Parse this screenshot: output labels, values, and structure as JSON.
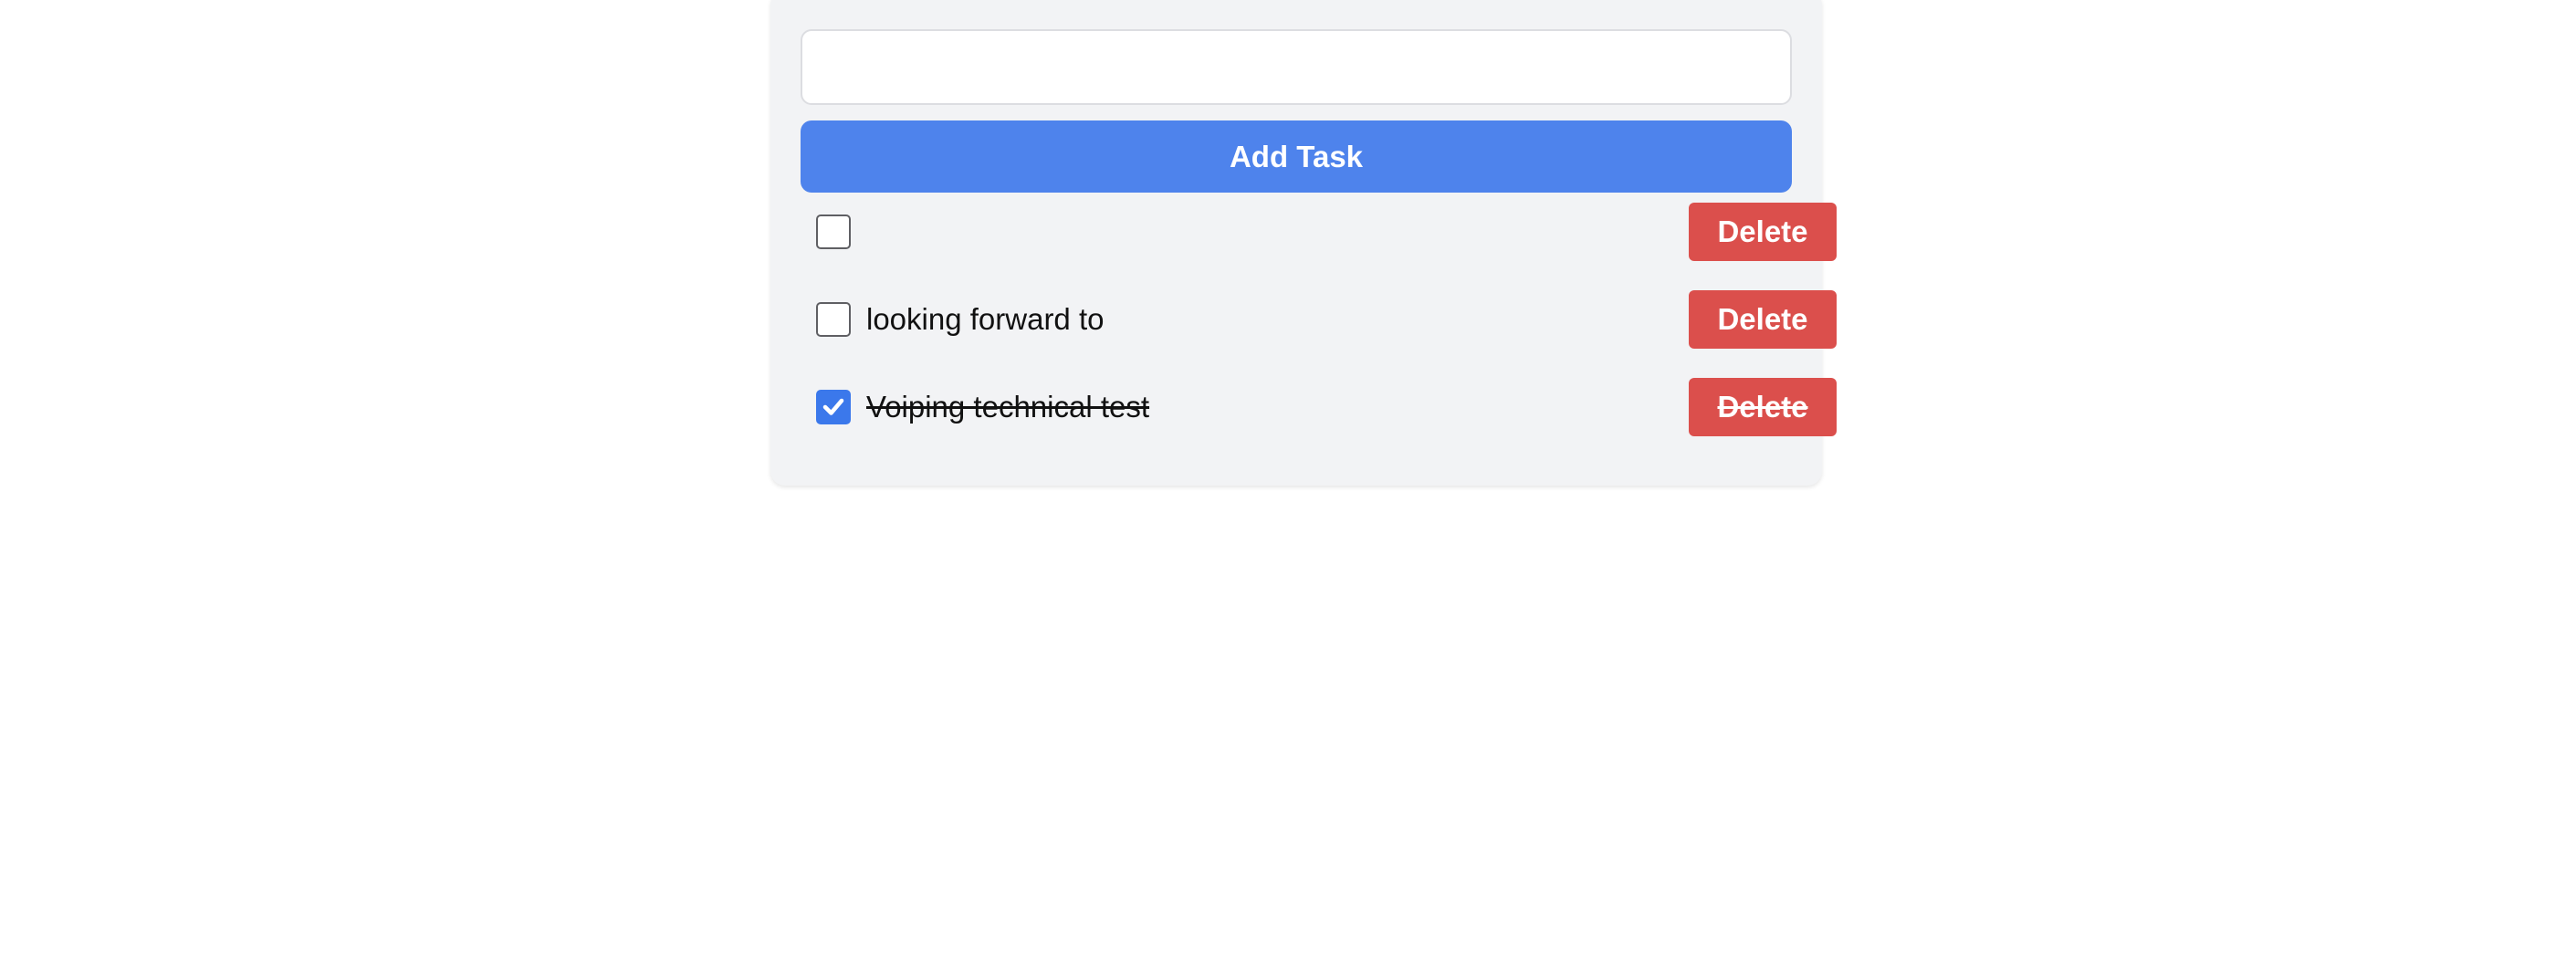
{
  "new_task": {
    "value": "",
    "placeholder": ""
  },
  "add_button_label": "Add Task",
  "tasks": [
    {
      "text": "",
      "completed": false,
      "delete_label": "Delete"
    },
    {
      "text": "looking forward to",
      "completed": false,
      "delete_label": "Delete"
    },
    {
      "text": "Voiping technical test",
      "completed": true,
      "delete_label": "Delete"
    }
  ],
  "colors": {
    "card_background": "#f2f3f5",
    "add_button": "#4e83ec",
    "delete_button": "#db4f4c",
    "checkbox_checked": "#3b78eb"
  }
}
